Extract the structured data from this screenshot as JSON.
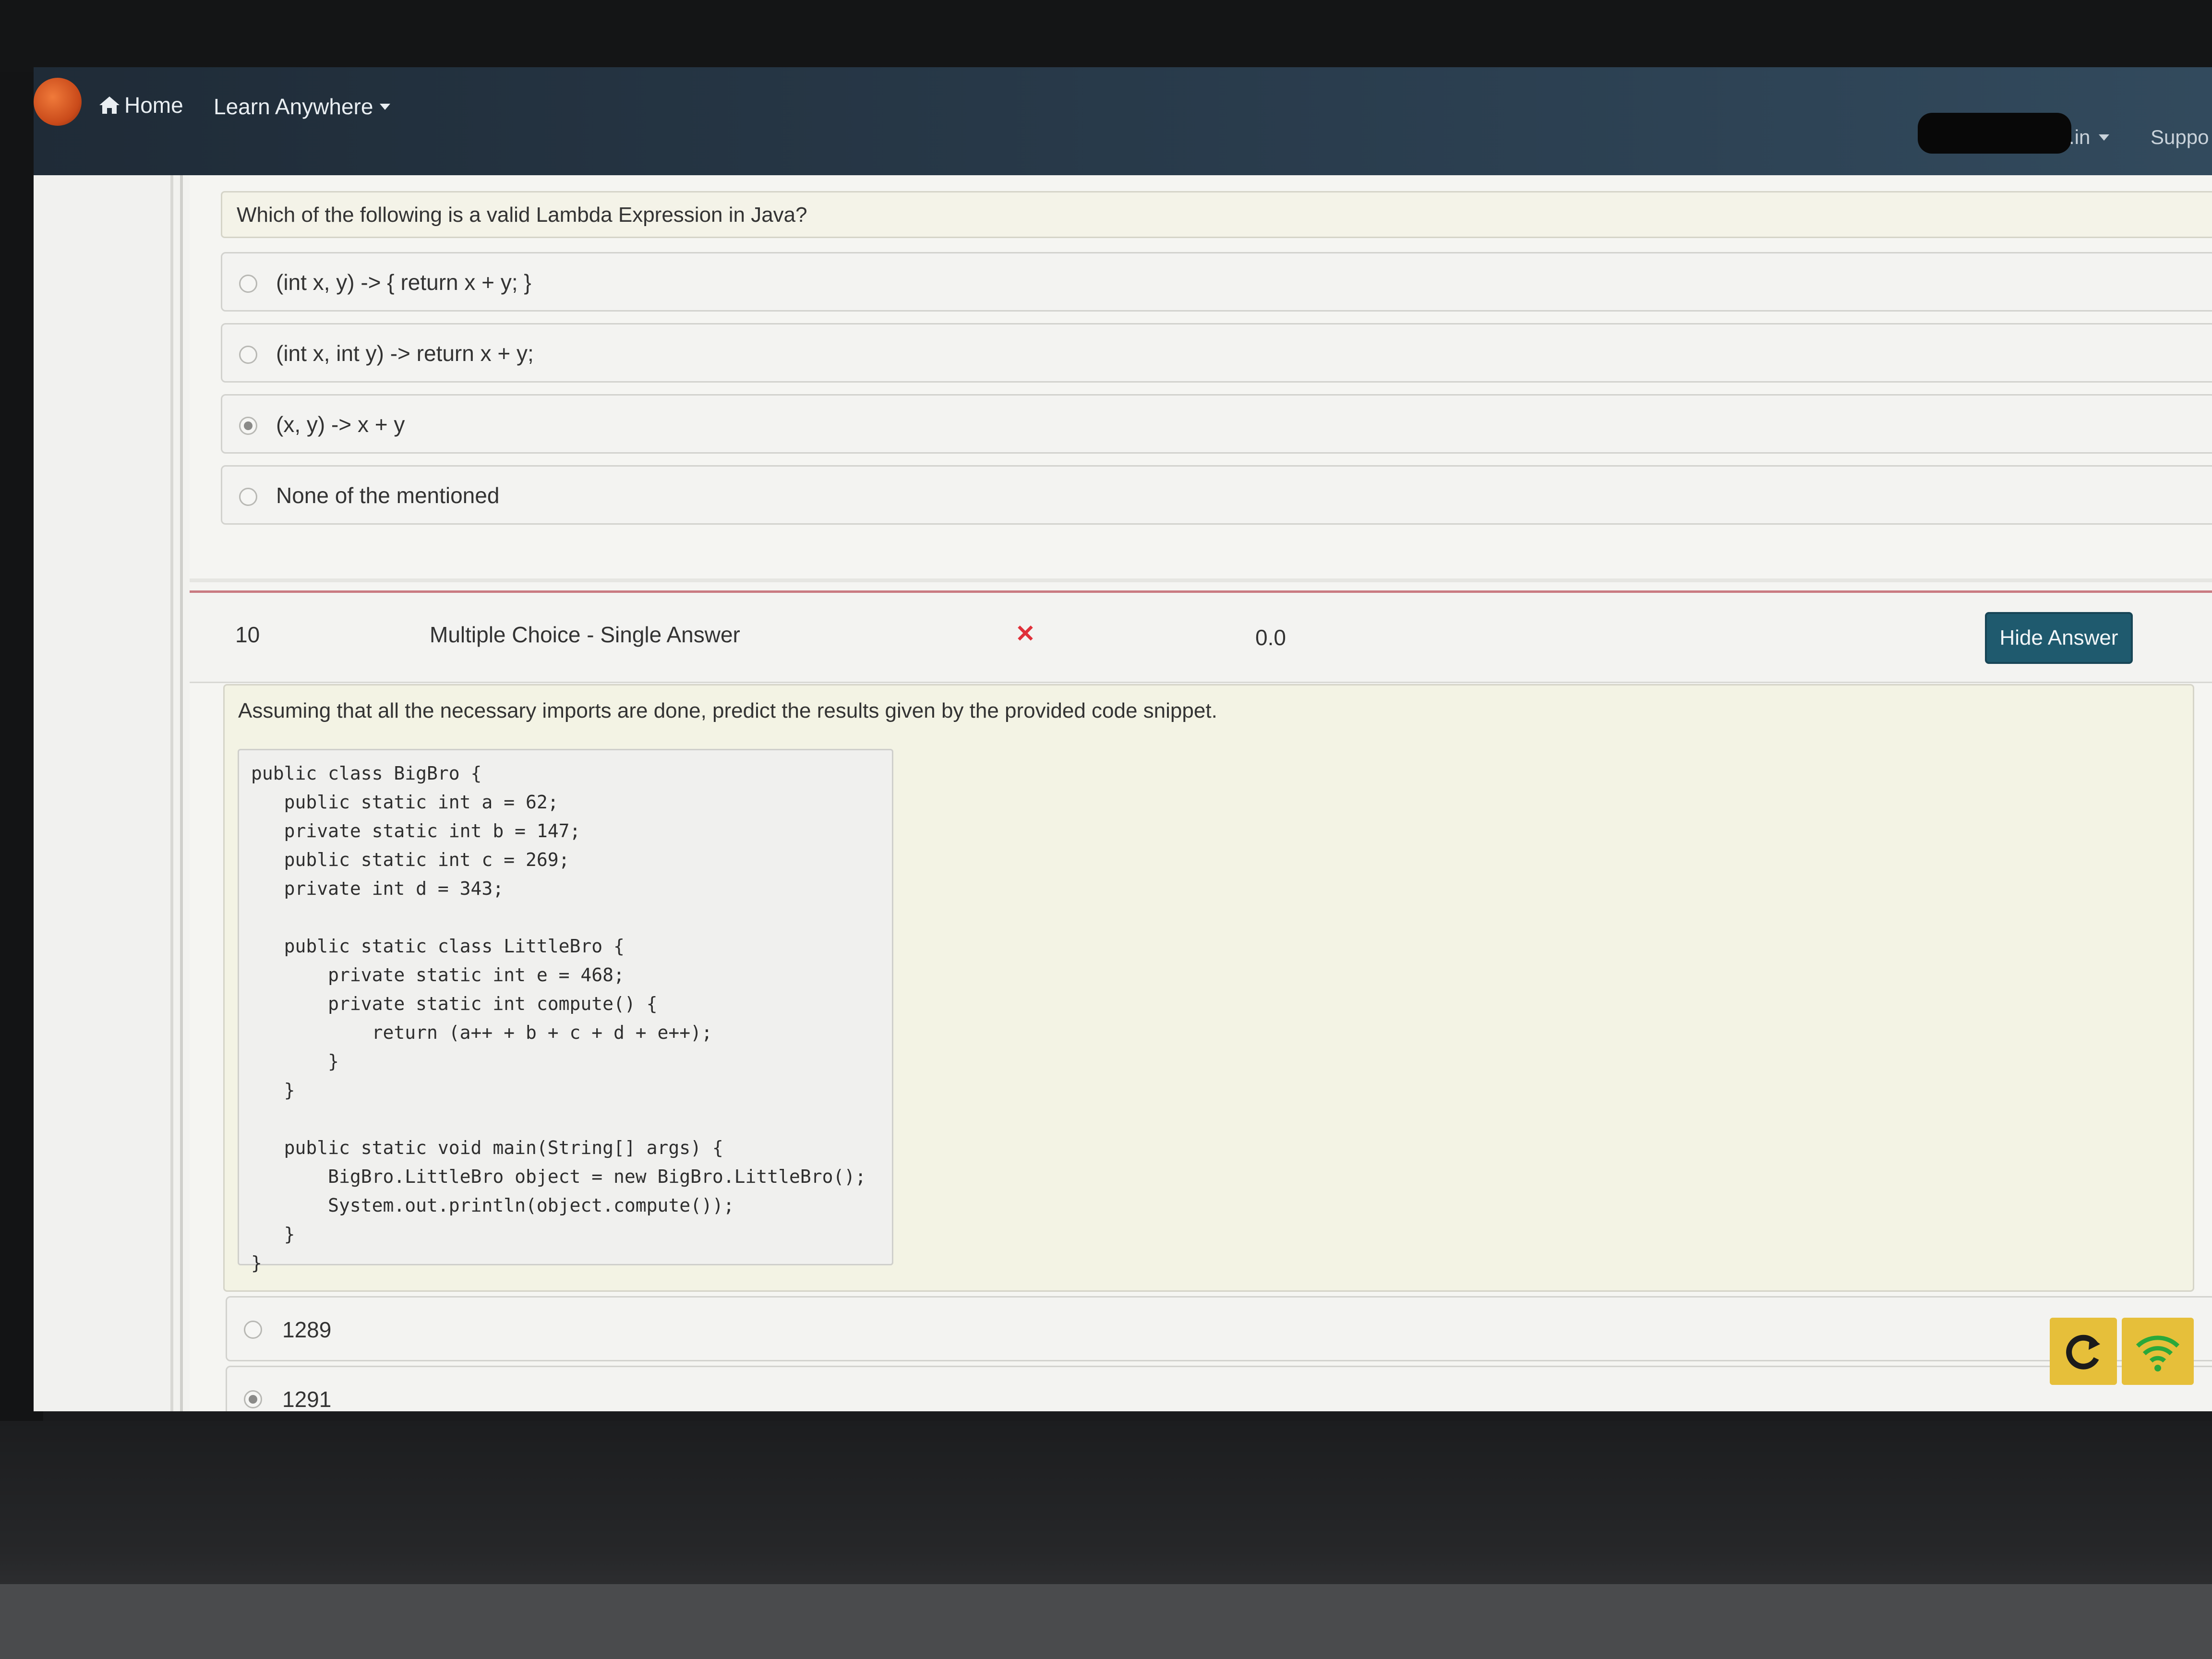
{
  "navbar": {
    "home_label": "Home",
    "learn_label": "Learn Anywhere",
    "account_label": ".in",
    "support_label": "Suppo"
  },
  "question_9": {
    "text": "Which of the following is a valid Lambda Expression in Java?",
    "options": [
      {
        "label": "(int x, y) -> { return x + y; }",
        "selected": false
      },
      {
        "label": "(int x, int y) -> return x + y;",
        "selected": false
      },
      {
        "label": "(x, y) -> x + y",
        "selected": true
      },
      {
        "label": "None of the mentioned",
        "selected": false
      }
    ]
  },
  "question_10": {
    "number": "10",
    "type": "Multiple Choice - Single Answer",
    "result_icon": "cross-icon",
    "score": "0.0",
    "hide_answer_label": "Hide Answer",
    "text": "Assuming that all the necessary imports are done, predict the results given by the provided code snippet.",
    "code_lines": [
      "public class BigBro {",
      "   public static int a = 62;",
      "   private static int b = 147;",
      "   public static int c = 269;",
      "   private int d = 343;",
      "",
      "   public static class LittleBro {",
      "       private static int e = 468;",
      "       private static int compute() {",
      "           return (a++ + b + c + d + e++);",
      "       }",
      "   }",
      "",
      "   public static void main(String[] args) {",
      "       BigBro.LittleBro object = new BigBro.LittleBro();",
      "       System.out.println(object.compute());",
      "   }",
      "}"
    ],
    "options": [
      {
        "label": "1289",
        "selected": false
      },
      {
        "label": "1291",
        "selected": true
      }
    ]
  },
  "toolbar": {
    "refresh_icon": "refresh-icon",
    "wifi_icon": "wifi-icon"
  },
  "colors": {
    "navbar": "#2a3d4e",
    "button": "#1f5a6e",
    "error": "#e0303a",
    "tool": "#e6bf3a"
  }
}
